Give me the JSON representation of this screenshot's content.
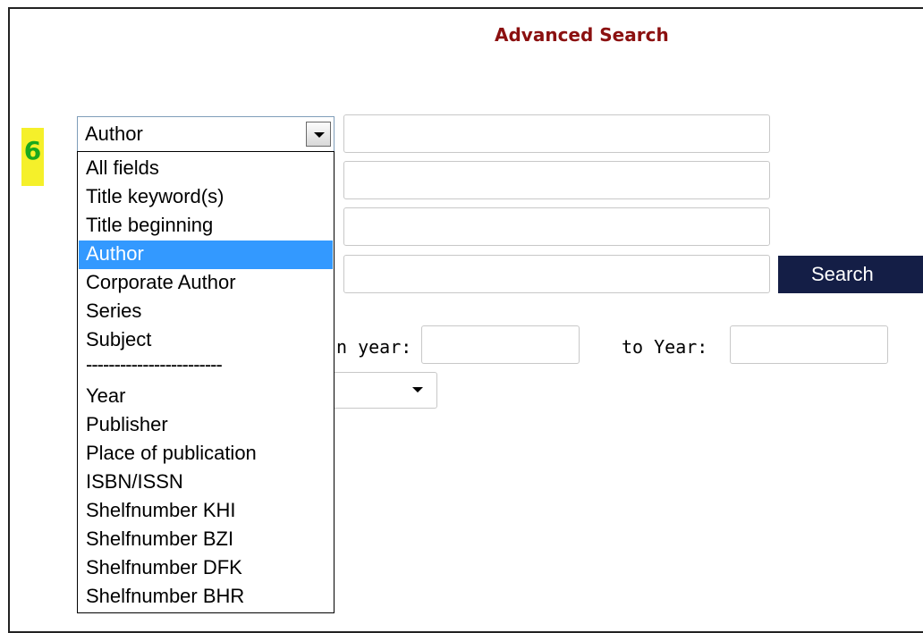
{
  "header": {
    "title": "Advanced Search",
    "title_color": "#8b1010"
  },
  "step_badge": {
    "label": "6",
    "background": "#f5f02a",
    "color": "#19a81d"
  },
  "field_select": {
    "selected": "Author",
    "options": [
      "All fields",
      "Title keyword(s)",
      "Title beginning",
      "Author",
      "Corporate Author",
      "Series",
      "Subject",
      "------------------------",
      "Year",
      "Publisher",
      "Place of publication",
      "ISBN/ISSN",
      "Shelfnumber KHI",
      "Shelfnumber BZI",
      "Shelfnumber DFK",
      "Shelfnumber BHR"
    ],
    "selected_index": 3,
    "highlight_color": "#3399ff"
  },
  "search_fields": [
    {
      "value": ""
    },
    {
      "value": ""
    },
    {
      "value": ""
    },
    {
      "value": ""
    }
  ],
  "search_button": {
    "label": "Search",
    "background": "#141e46"
  },
  "year_range": {
    "from_label": "n year:",
    "from_value": "",
    "to_label": "to Year:",
    "to_value": ""
  },
  "secondary_select": {
    "value": ""
  }
}
